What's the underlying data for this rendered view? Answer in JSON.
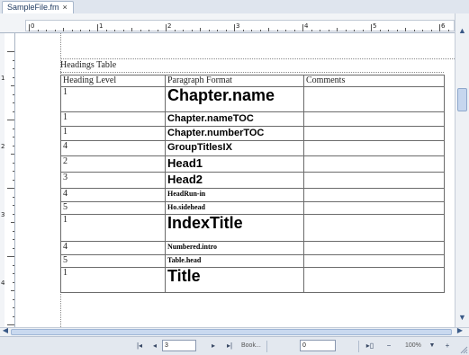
{
  "tab": {
    "filename": "SampleFile.fm",
    "close": "×"
  },
  "ruler": {
    "horizontal_numbers": [
      "0",
      "1",
      "2",
      "3",
      "4",
      "5",
      "6"
    ],
    "vertical_numbers": [
      "1",
      "2",
      "3",
      "4"
    ]
  },
  "document": {
    "table_title": "Headings Table",
    "columns": [
      "Heading Level",
      "Paragraph Format",
      "Comments"
    ],
    "rows": [
      {
        "level": "1",
        "format": "Chapter.name",
        "comments": ""
      },
      {
        "level": "1",
        "format": "Chapter.nameTOC",
        "comments": ""
      },
      {
        "level": "1",
        "format": "Chapter.numberTOC",
        "comments": ""
      },
      {
        "level": "4",
        "format": "GroupTitlesIX",
        "comments": ""
      },
      {
        "level": "2",
        "format": "Head1",
        "comments": ""
      },
      {
        "level": "3",
        "format": "Head2",
        "comments": ""
      },
      {
        "level": "4",
        "format": "HeadRun-in",
        "comments": ""
      },
      {
        "level": "5",
        "format": "Ho.sidehead",
        "comments": ""
      },
      {
        "level": "1",
        "format": "IndexTitle",
        "comments": ""
      },
      {
        "level": "4",
        "format": "Numbered.intro",
        "comments": ""
      },
      {
        "level": "5",
        "format": "Table.head",
        "comments": ""
      },
      {
        "level": "1",
        "format": "Title",
        "comments": ""
      }
    ]
  },
  "statusbar": {
    "page_field": "3",
    "book_label": "Book...",
    "second_field": "0",
    "zoom": "100%",
    "zoom_minus": "−",
    "zoom_plus": "+"
  }
}
